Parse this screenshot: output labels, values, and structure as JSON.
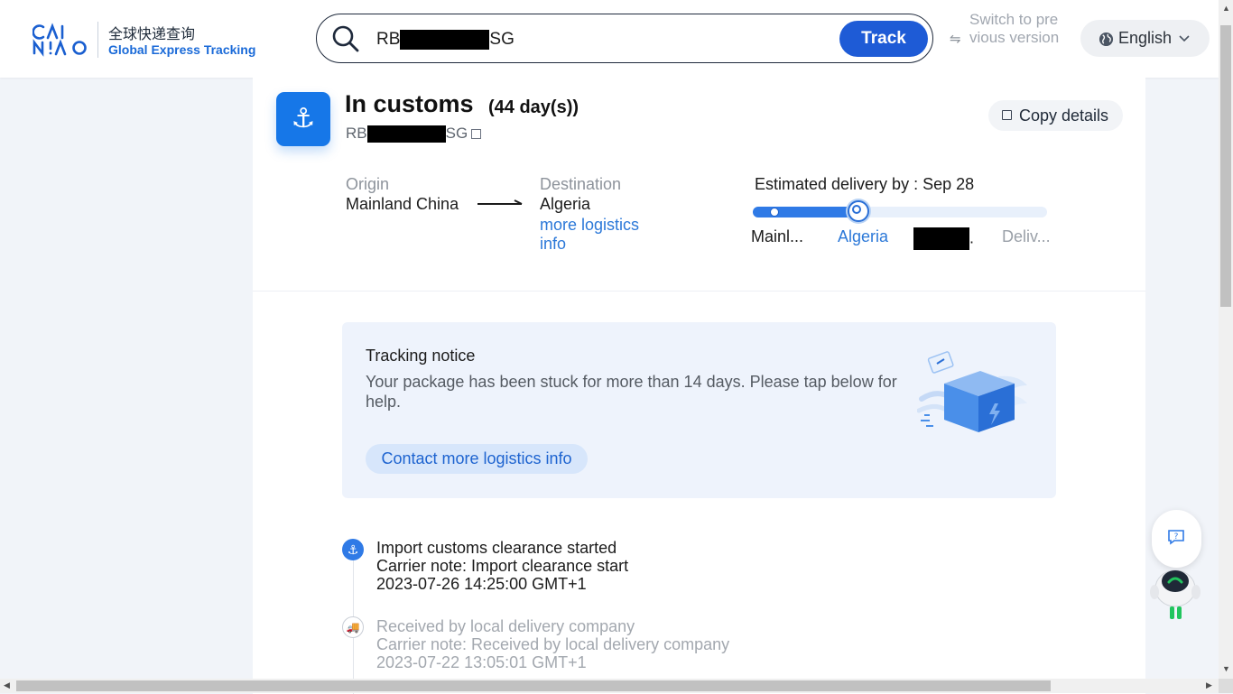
{
  "header": {
    "logo_mark": "CAINIAO",
    "logo_cn": "全球快递查询",
    "logo_en": "Global Express Tracking",
    "search": {
      "value_prefix": "RB",
      "value_suffix": "SG",
      "track_label": "Track"
    },
    "switch_text": "Switch to previous version",
    "language": "English"
  },
  "summary": {
    "status": "In customs",
    "days": "(44 day(s))",
    "tracking_prefix": "RB",
    "tracking_suffix": "SG",
    "copy_details": "Copy details",
    "origin_label": "Origin",
    "origin_value": "Mainland China",
    "destination_label": "Destination",
    "destination_value": "Algeria",
    "more_info_link": "more logistics info",
    "eta": "Estimated delivery by : Sep 28",
    "progress": {
      "fraction": 0.36,
      "steps": [
        "Mainl...",
        "Algeria",
        "",
        "Deliv..."
      ],
      "step3_trail": "."
    }
  },
  "notice": {
    "title": "Tracking notice",
    "text": "Your package has been stuck for more than 14 days. Please tap below for help.",
    "button": "Contact more logistics info"
  },
  "timeline": [
    {
      "title": "Import customs clearance started",
      "note": "Carrier note: Import clearance start",
      "time": "2023-07-26 14:25:00 GMT+1"
    },
    {
      "title": "Received by local delivery company",
      "note": "Carrier note: Received by local delivery company",
      "time": "2023-07-22 13:05:01 GMT+1"
    }
  ],
  "colors": {
    "brand": "#1e5bd6",
    "link": "#2b78d8",
    "page_bg": "#f1f4f9",
    "notice_bg": "#eef3fc"
  },
  "icons": {
    "search": "search-icon",
    "status": "anchor-icon",
    "switch": "swap-icon",
    "language": "globe-icon",
    "help": "help-chat-icon"
  }
}
